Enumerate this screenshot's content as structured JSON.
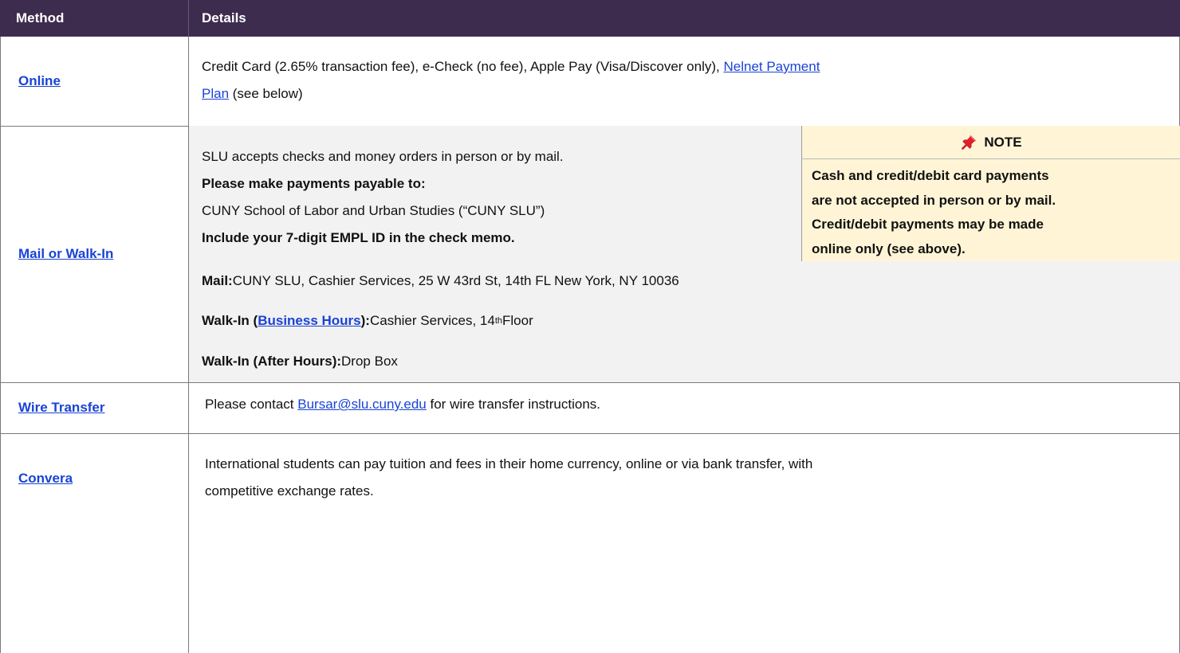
{
  "header": {
    "method": "Method",
    "details": "Details"
  },
  "online": {
    "method": "Online",
    "text_before": "Credit Card (2.65% transaction fee), e-Check (no fee), Apple Pay (Visa/Discover only), ",
    "link_line1": "Nelnet Payment",
    "link_line2": "Plan",
    "text_after": " (see below)"
  },
  "mail": {
    "method": "Mail or Walk-In",
    "line1": "SLU accepts checks and money orders in person or by mail.",
    "line2": "Please make payments payable to:",
    "line3": "CUNY School of Labor and Urban Studies (“CUNY SLU”)",
    "line4": "Include your 7-digit EMPL ID in the check memo.",
    "note_title": "NOTE",
    "note_l1": "Cash and credit/debit card payments",
    "note_l2": "are not accepted in person or by mail.",
    "note_l3": "Credit/debit payments may be made",
    "note_l4": "online only (see above).",
    "mail_label": "Mail:",
    "mail_text": " CUNY SLU, Cashier Services, 25 W 43rd St, 14th FL New York, NY 10036",
    "walkin_label_start": "Walk-In (",
    "walkin_link": "Business Hours",
    "walkin_label_end": "):",
    "walkin_text_a": " Cashier Services, 14",
    "walkin_sup": "th",
    "walkin_text_b": " Floor",
    "after_label": "Walk-In (After Hours):",
    "after_text": " Drop Box"
  },
  "wire": {
    "method": "Wire Transfer",
    "text_before": "Please contact ",
    "email": "Bursar@slu.cuny.edu",
    "text_after": " for wire transfer instructions."
  },
  "convera": {
    "method": "Convera",
    "line1": "International students can pay tuition and fees in their home currency, online or via bank transfer, with",
    "line2": "competitive exchange rates."
  },
  "colors": {
    "header_bg": "#3e2c4e",
    "link": "#1a43d6",
    "note_bg": "#fff5d6",
    "pin": "#e0202a"
  },
  "icons": {
    "note": "pushpin-icon"
  }
}
